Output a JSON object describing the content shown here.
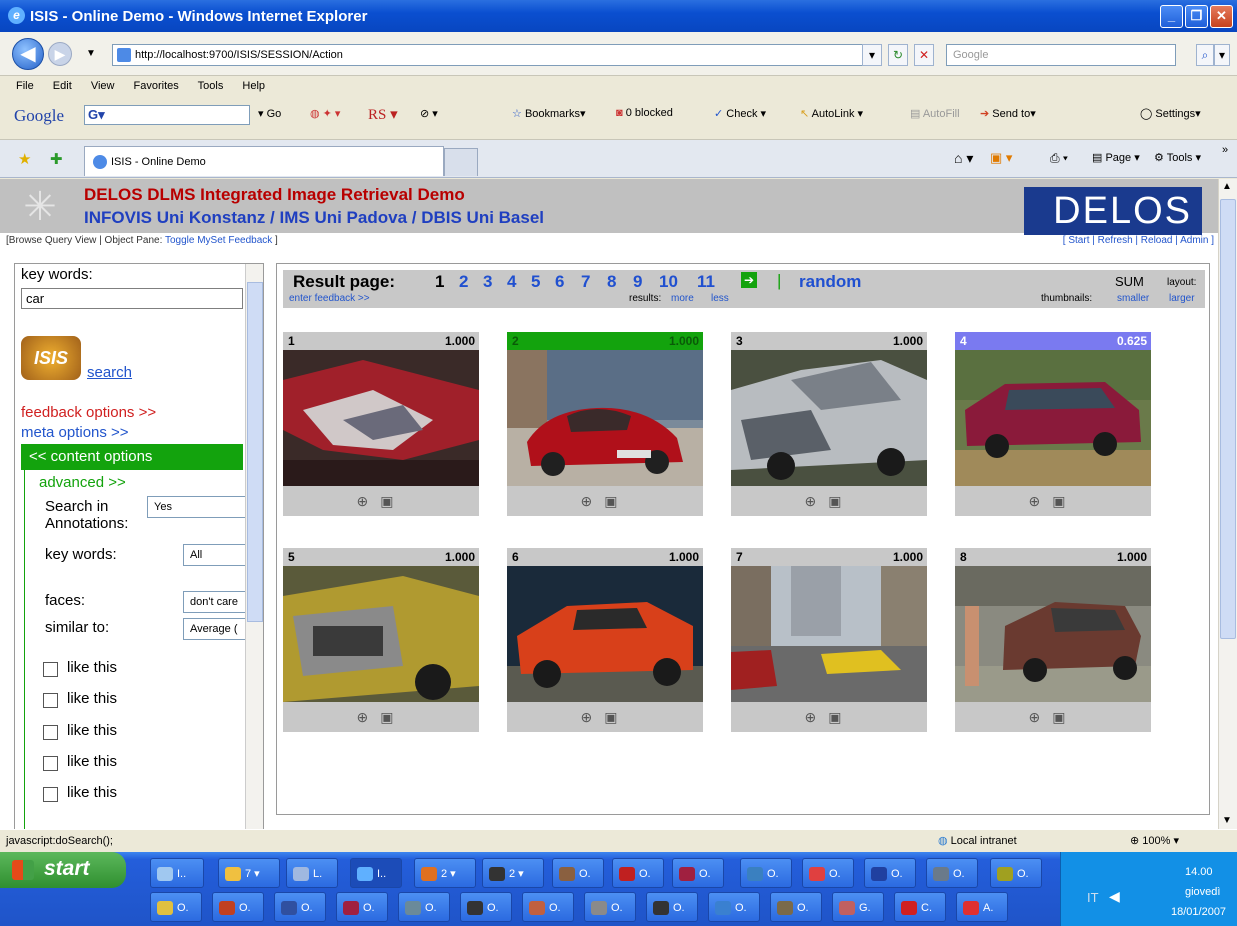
{
  "window": {
    "title": "ISIS - Online Demo - Windows Internet Explorer"
  },
  "nav": {
    "url": "http://localhost:9700/ISIS/SESSION/Action",
    "search_placeholder": "Google"
  },
  "menu": [
    "File",
    "Edit",
    "View",
    "Favorites",
    "Tools",
    "Help"
  ],
  "googlebar": {
    "brand": "Google",
    "go": "Go",
    "rs": "RS",
    "bookmarks": "Bookmarks",
    "blocked": "0 blocked",
    "check": "Check",
    "autolink": "AutoLink",
    "autofill": "AutoFill",
    "sendto": "Send to",
    "settings": "Settings"
  },
  "tabs": {
    "active": "ISIS - Online Demo",
    "page": "Page",
    "tools": "Tools"
  },
  "site": {
    "title1": "DELOS DLMS Integrated Image Retrieval Demo",
    "title2": "INFOVIS Uni Konstanz / IMS Uni Padova / DBIS Uni Basel",
    "logo": "DELOS",
    "links_left_prefix": "[Browse Query View | Object Pane: ",
    "links_left_toggle": "Toggle MySet Feedback",
    "links_left_suffix": " ]",
    "links_right": "[ Start | Refresh | Reload | Admin ]"
  },
  "left": {
    "keywords_label": "key words:",
    "keywords_value": "car",
    "search": "search",
    "feedback_options": "feedback options >>",
    "meta_options": "meta options >>",
    "content_options": "<< content options",
    "advanced": "advanced >>",
    "search_in_label1": "Search in",
    "search_in_label2": "Annotations:",
    "search_in_value": "Yes",
    "keywords2_label": "key words:",
    "keywords2_value": "All",
    "faces_label": "faces:",
    "faces_value": "don't care",
    "similar_label": "similar to:",
    "similar_value": "Average (",
    "like_this": [
      "like this",
      "like this",
      "like this",
      "like this",
      "like this"
    ]
  },
  "results": {
    "label": "Result page:",
    "pages": [
      "1",
      "2",
      "3",
      "4",
      "5",
      "6",
      "7",
      "8",
      "9",
      "10",
      "11"
    ],
    "random": "random",
    "sum": "SUM",
    "layout": "layout:",
    "enter_feedback": "enter feedback >>",
    "results_label": "results:",
    "more": "more",
    "less": "less",
    "thumbnails_label": "thumbnails:",
    "smaller": "smaller",
    "larger": "larger",
    "items": [
      {
        "n": "1",
        "score": "1.000",
        "bar": "#c8c8c8"
      },
      {
        "n": "2",
        "score": "1.000",
        "bar": "#13a30d"
      },
      {
        "n": "3",
        "score": "1.000",
        "bar": "#c8c8c8"
      },
      {
        "n": "4",
        "score": "0.625",
        "bar": "#7a7af0"
      },
      {
        "n": "5",
        "score": "1.000",
        "bar": "#c8c8c8"
      },
      {
        "n": "6",
        "score": "1.000",
        "bar": "#c8c8c8"
      },
      {
        "n": "7",
        "score": "1.000",
        "bar": "#c8c8c8"
      },
      {
        "n": "8",
        "score": "1.000",
        "bar": "#c8c8c8"
      }
    ]
  },
  "status": {
    "text": "javascript:doSearch();",
    "zone": "Local intranet",
    "zoom": "100%"
  },
  "taskbar": {
    "start": "start",
    "time": "14.00",
    "day": "giovedì",
    "date": "18/01/2007",
    "lang": "IT",
    "row1": [
      "I..",
      "7",
      "L.",
      "I..",
      "2",
      "2",
      "O.",
      "O.",
      "O.",
      "O.",
      "O.",
      "O.",
      "O.",
      "O."
    ],
    "row2": [
      "O.",
      "O.",
      "O.",
      "O.",
      "O.",
      "O.",
      "O.",
      "O.",
      "O.",
      "O.",
      "O.",
      "G.",
      "C.",
      "A."
    ]
  }
}
